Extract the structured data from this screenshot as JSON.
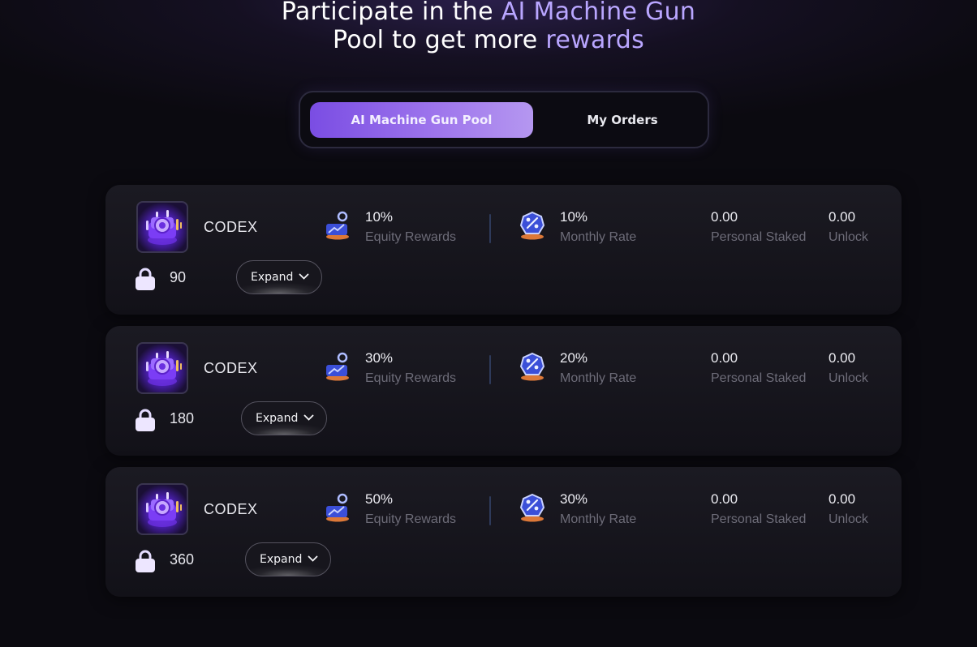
{
  "headline": {
    "line1_a": "Participate in the ",
    "line1_b": "AI Machine Gun",
    "line2_a": "Pool to get more ",
    "line2_b": "rewards"
  },
  "tabs": {
    "active": "AI Machine Gun Pool",
    "orders": "My Orders"
  },
  "colors": {
    "accent": "#8b5ff0",
    "highlight_text": "#b9a6ff",
    "label_text": "#6d6c78",
    "icon_orange": "#ff8a3d"
  },
  "icons": {
    "coin_logo": "robot-coin-icon",
    "lock": "lock-icon",
    "equity": "person-chart-icon",
    "rate": "percent-badge-icon",
    "chevron": "chevron-down-icon"
  },
  "pools": [
    {
      "name": "CODEX",
      "lock_days": "90",
      "expand_label": "Expand",
      "equity_value": "10%",
      "equity_label": "Equity Rewards",
      "rate_value": "10%",
      "rate_label": "Monthly Rate",
      "staked_value": "0.00",
      "staked_label": "Personal Staked",
      "unlock_value": "0.00",
      "unlock_label": "Unlock"
    },
    {
      "name": "CODEX",
      "lock_days": "180",
      "expand_label": "Expand",
      "equity_value": "30%",
      "equity_label": "Equity Rewards",
      "rate_value": "20%",
      "rate_label": "Monthly Rate",
      "staked_value": "0.00",
      "staked_label": "Personal Staked",
      "unlock_value": "0.00",
      "unlock_label": "Unlock"
    },
    {
      "name": "CODEX",
      "lock_days": "360",
      "expand_label": "Expand",
      "equity_value": "50%",
      "equity_label": "Equity Rewards",
      "rate_value": "30%",
      "rate_label": "Monthly Rate",
      "staked_value": "0.00",
      "staked_label": "Personal Staked",
      "unlock_value": "0.00",
      "unlock_label": "Unlock"
    }
  ]
}
